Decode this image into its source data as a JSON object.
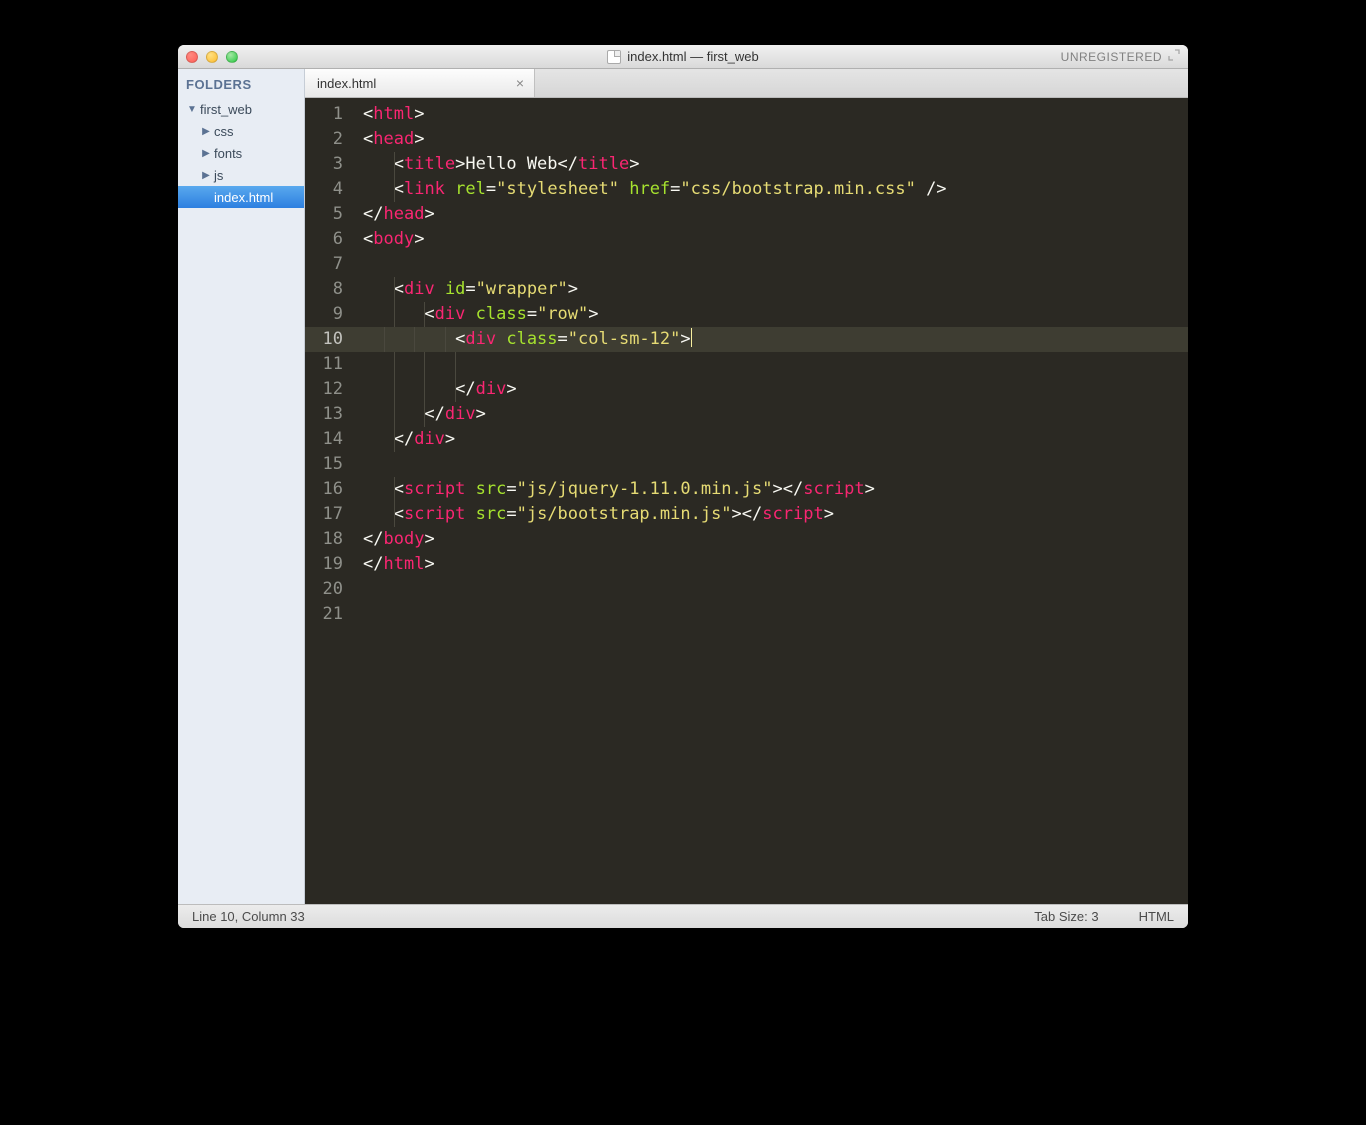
{
  "titlebar": {
    "title": "index.html — first_web",
    "registration": "UNREGISTERED"
  },
  "sidebar": {
    "header": "FOLDERS",
    "root": {
      "label": "first_web",
      "expanded": true
    },
    "folders": [
      {
        "label": "css"
      },
      {
        "label": "fonts"
      },
      {
        "label": "js"
      }
    ],
    "files": [
      {
        "label": "index.html",
        "selected": true
      }
    ]
  },
  "tabs": [
    {
      "label": "index.html",
      "active": true
    }
  ],
  "editor": {
    "lineCount": 21,
    "currentLine": 10,
    "lines": [
      {
        "n": 1,
        "indent": 0,
        "tokens": [
          [
            "p",
            "<"
          ],
          [
            "tn",
            "html"
          ],
          [
            "p",
            ">"
          ]
        ]
      },
      {
        "n": 2,
        "indent": 0,
        "tokens": [
          [
            "p",
            "<"
          ],
          [
            "tn",
            "head"
          ],
          [
            "p",
            ">"
          ]
        ]
      },
      {
        "n": 3,
        "indent": 1,
        "tokens": [
          [
            "p",
            "<"
          ],
          [
            "tn",
            "title"
          ],
          [
            "p",
            ">"
          ],
          [
            "txt",
            "Hello Web"
          ],
          [
            "p",
            "</"
          ],
          [
            "tn",
            "title"
          ],
          [
            "p",
            ">"
          ]
        ]
      },
      {
        "n": 4,
        "indent": 1,
        "tokens": [
          [
            "p",
            "<"
          ],
          [
            "tn",
            "link"
          ],
          [
            "p",
            " "
          ],
          [
            "attr",
            "rel"
          ],
          [
            "p",
            "="
          ],
          [
            "str",
            "\"stylesheet\""
          ],
          [
            "p",
            " "
          ],
          [
            "attr",
            "href"
          ],
          [
            "p",
            "="
          ],
          [
            "str",
            "\"css/bootstrap.min.css\""
          ],
          [
            "p",
            " />"
          ]
        ]
      },
      {
        "n": 5,
        "indent": 0,
        "tokens": [
          [
            "p",
            "</"
          ],
          [
            "tn",
            "head"
          ],
          [
            "p",
            ">"
          ]
        ]
      },
      {
        "n": 6,
        "indent": 0,
        "tokens": [
          [
            "p",
            "<"
          ],
          [
            "tn",
            "body"
          ],
          [
            "p",
            ">"
          ]
        ]
      },
      {
        "n": 7,
        "indent": 0,
        "tokens": []
      },
      {
        "n": 8,
        "indent": 1,
        "tokens": [
          [
            "p",
            "<"
          ],
          [
            "tn",
            "div"
          ],
          [
            "p",
            " "
          ],
          [
            "attr",
            "id"
          ],
          [
            "p",
            "="
          ],
          [
            "str",
            "\"wrapper\""
          ],
          [
            "p",
            ">"
          ]
        ]
      },
      {
        "n": 9,
        "indent": 2,
        "tokens": [
          [
            "p",
            "<"
          ],
          [
            "tn",
            "div"
          ],
          [
            "p",
            " "
          ],
          [
            "attr",
            "class"
          ],
          [
            "p",
            "="
          ],
          [
            "str",
            "\"row\""
          ],
          [
            "p",
            ">"
          ]
        ]
      },
      {
        "n": 10,
        "indent": 3,
        "tokens": [
          [
            "p",
            "<"
          ],
          [
            "tn",
            "div"
          ],
          [
            "p",
            " "
          ],
          [
            "attr",
            "class"
          ],
          [
            "p",
            "="
          ],
          [
            "str",
            "\"col-sm-12\""
          ],
          [
            "p",
            ">"
          ]
        ],
        "caret": true
      },
      {
        "n": 11,
        "indent": 3,
        "tokens": []
      },
      {
        "n": 12,
        "indent": 3,
        "tokens": [
          [
            "p",
            "</"
          ],
          [
            "tn",
            "div"
          ],
          [
            "p",
            ">"
          ]
        ]
      },
      {
        "n": 13,
        "indent": 2,
        "tokens": [
          [
            "p",
            "</"
          ],
          [
            "tn",
            "div"
          ],
          [
            "p",
            ">"
          ]
        ]
      },
      {
        "n": 14,
        "indent": 1,
        "tokens": [
          [
            "p",
            "</"
          ],
          [
            "tn",
            "div"
          ],
          [
            "p",
            ">"
          ]
        ]
      },
      {
        "n": 15,
        "indent": 0,
        "tokens": []
      },
      {
        "n": 16,
        "indent": 1,
        "tokens": [
          [
            "p",
            "<"
          ],
          [
            "tn",
            "script"
          ],
          [
            "p",
            " "
          ],
          [
            "attr",
            "src"
          ],
          [
            "p",
            "="
          ],
          [
            "str",
            "\"js/jquery-1.11.0.min.js\""
          ],
          [
            "p",
            ">"
          ],
          [
            "p",
            "</"
          ],
          [
            "tn",
            "script"
          ],
          [
            "p",
            ">"
          ]
        ]
      },
      {
        "n": 17,
        "indent": 1,
        "tokens": [
          [
            "p",
            "<"
          ],
          [
            "tn",
            "script"
          ],
          [
            "p",
            " "
          ],
          [
            "attr",
            "src"
          ],
          [
            "p",
            "="
          ],
          [
            "str",
            "\"js/bootstrap.min.js\""
          ],
          [
            "p",
            ">"
          ],
          [
            "p",
            "</"
          ],
          [
            "tn",
            "script"
          ],
          [
            "p",
            ">"
          ]
        ]
      },
      {
        "n": 18,
        "indent": 0,
        "tokens": [
          [
            "p",
            "</"
          ],
          [
            "tn",
            "body"
          ],
          [
            "p",
            ">"
          ]
        ]
      },
      {
        "n": 19,
        "indent": 0,
        "tokens": [
          [
            "p",
            "</"
          ],
          [
            "tn",
            "html"
          ],
          [
            "p",
            ">"
          ]
        ]
      },
      {
        "n": 20,
        "indent": 0,
        "tokens": []
      },
      {
        "n": 21,
        "indent": 0,
        "tokens": []
      }
    ],
    "indentSize": 3
  },
  "statusbar": {
    "position": "Line 10, Column 33",
    "tabSize": "Tab Size: 3",
    "syntax": "HTML"
  }
}
